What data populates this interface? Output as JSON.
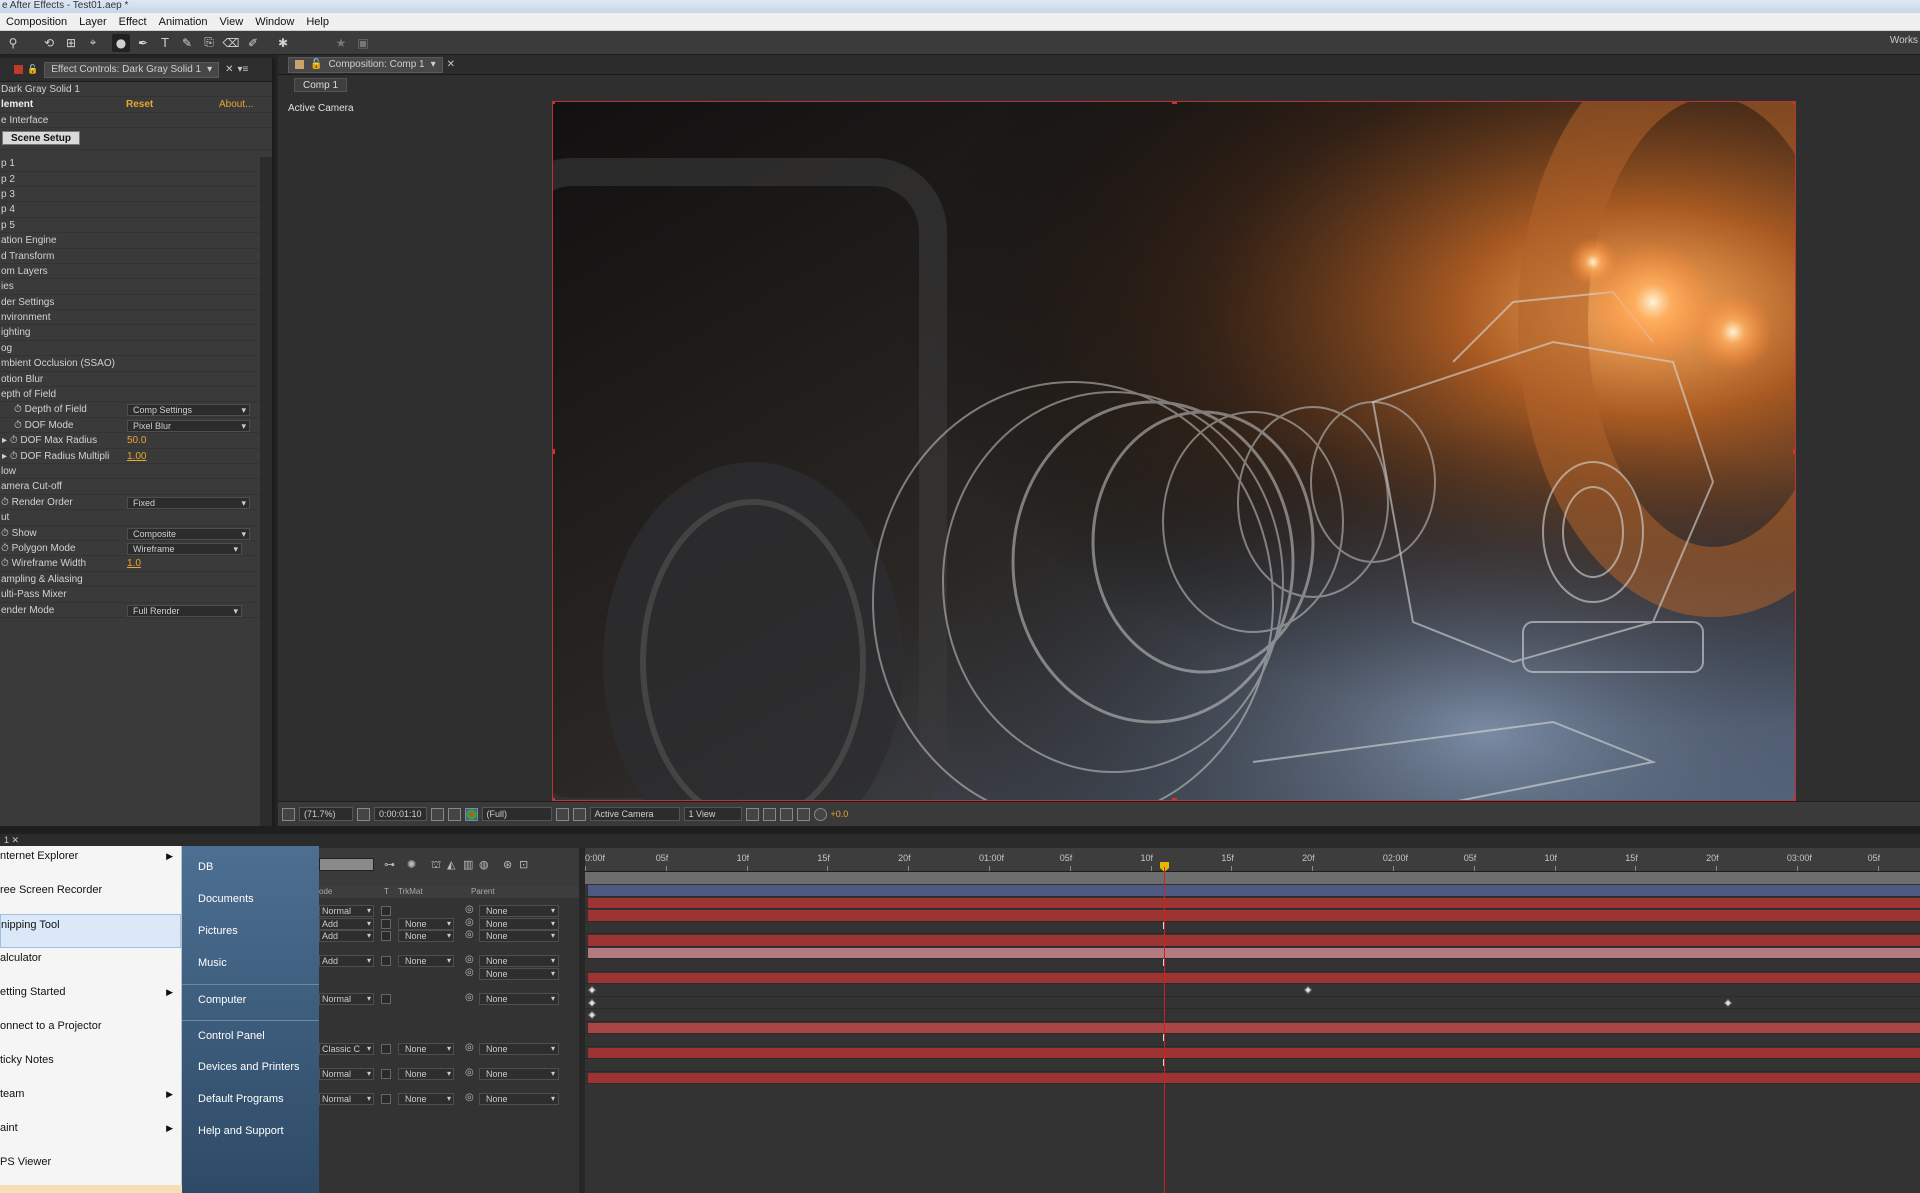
{
  "window": {
    "title": "e After Effects - Test01.aep *"
  },
  "menu": [
    "Composition",
    "Layer",
    "Effect",
    "Animation",
    "View",
    "Window",
    "Help"
  ],
  "toolbar": {
    "workspace_label": "Works"
  },
  "effect_panel": {
    "tab_label": "Effect Controls: Dark Gray Solid 1",
    "layer_name": "Dark Gray Solid 1",
    "effect_name": "lement",
    "reset_label": "Reset",
    "about_label": "About...",
    "interface_label": "e Interface",
    "scene_setup_label": "Scene Setup",
    "groups": [
      "p 1",
      "p 2",
      "p 3",
      "p 4",
      "p 5",
      "ation Engine",
      "d Transform",
      "om Layers",
      "ies",
      "der Settings",
      "nvironment",
      "ighting",
      "og",
      "mbient Occlusion (SSAO)",
      "otion Blur",
      "epth of Field"
    ],
    "dof": {
      "depth_of_field": {
        "label": "Depth of Field",
        "value": "Comp Settings"
      },
      "dof_mode": {
        "label": "DOF Mode",
        "value": "Pixel Blur"
      },
      "max_radius": {
        "label": "DOF Max Radius",
        "value": "50.0"
      },
      "radius_mult": {
        "label": "DOF Radius Multipli",
        "value": "1.00"
      }
    },
    "glow_label": "low",
    "camera_cutoff_label": "amera Cut-off",
    "render_order": {
      "label": "Render Order",
      "value": "Fixed"
    },
    "out_label": "ut",
    "show": {
      "label": "Show",
      "value": "Composite"
    },
    "polygon_mode": {
      "label": "Polygon Mode",
      "value": "Wireframe"
    },
    "wireframe_width": {
      "label": "Wireframe Width",
      "value": "1.0"
    },
    "sampling_label": "ampling & Aliasing",
    "multipass_label": "ulti-Pass Mixer",
    "render_mode": {
      "label": "ender Mode",
      "value": "Full Render"
    }
  },
  "composition": {
    "tab_label": "Composition: Comp 1",
    "comp_chip": "Comp 1",
    "active_camera_label": "Active Camera",
    "bottom_bar": {
      "zoom": "(71.7%)",
      "timecode": "0:00:01:10",
      "resolution": "(Full)",
      "camera": "Active Camera",
      "views": "1 View",
      "exposure": "+0.0"
    }
  },
  "timeline": {
    "tab_label": "1",
    "col_headers": {
      "mode": "ode",
      "t": "T",
      "trkmat": "TrkMat",
      "parent": "Parent"
    },
    "ruler_ticks": [
      "0:00f",
      "05f",
      "10f",
      "15f",
      "20f",
      "01:00f",
      "05f",
      "10f",
      "15f",
      "20f",
      "02:00f",
      "05f",
      "10f",
      "15f",
      "20f",
      "03:00f",
      "05f"
    ],
    "layers": [
      {
        "mode": "Normal",
        "trkmat": "",
        "parent": "None"
      },
      {
        "mode": "Add",
        "trkmat": "None",
        "parent": "None"
      },
      {
        "mode": "Add",
        "trkmat": "None",
        "parent": "None"
      },
      {
        "mode": "",
        "trkmat": "",
        "parent": ""
      },
      {
        "mode": "Add",
        "trkmat": "None",
        "parent": "None"
      },
      {
        "mode": "",
        "trkmat": "",
        "parent": "None"
      },
      {
        "mode": "",
        "trkmat": "",
        "parent": ""
      },
      {
        "mode": "Normal",
        "trkmat": "",
        "parent": "None"
      },
      {
        "mode": "",
        "trkmat": "",
        "parent": ""
      },
      {
        "mode": "",
        "trkmat": "",
        "parent": ""
      },
      {
        "mode": "",
        "trkmat": "",
        "parent": ""
      },
      {
        "mode": "Classic C",
        "trkmat": "None",
        "parent": "None"
      },
      {
        "mode": "",
        "trkmat": "",
        "parent": ""
      },
      {
        "mode": "Normal",
        "trkmat": "None",
        "parent": "None"
      },
      {
        "mode": "",
        "trkmat": "",
        "parent": ""
      },
      {
        "mode": "Normal",
        "trkmat": "None",
        "parent": "None"
      }
    ]
  },
  "start_menu": {
    "programs": [
      {
        "label": "nternet Explorer",
        "arrow": true
      },
      {
        "label": "ree Screen Recorder",
        "arrow": false
      },
      {
        "label": "nipping Tool",
        "arrow": false,
        "highlight": true
      },
      {
        "label": "alculator",
        "arrow": false
      },
      {
        "label": "etting Started",
        "arrow": true
      },
      {
        "label": "onnect to a Projector",
        "arrow": false
      },
      {
        "label": "ticky Notes",
        "arrow": false
      },
      {
        "label": "team",
        "arrow": true
      },
      {
        "label": "aint",
        "arrow": true
      },
      {
        "label": "PS Viewer",
        "arrow": false
      }
    ],
    "places": [
      "DB",
      "Documents",
      "Pictures",
      "Music",
      "Computer",
      "Control Panel",
      "Devices and Printers",
      "Default Programs",
      "Help and Support"
    ]
  }
}
